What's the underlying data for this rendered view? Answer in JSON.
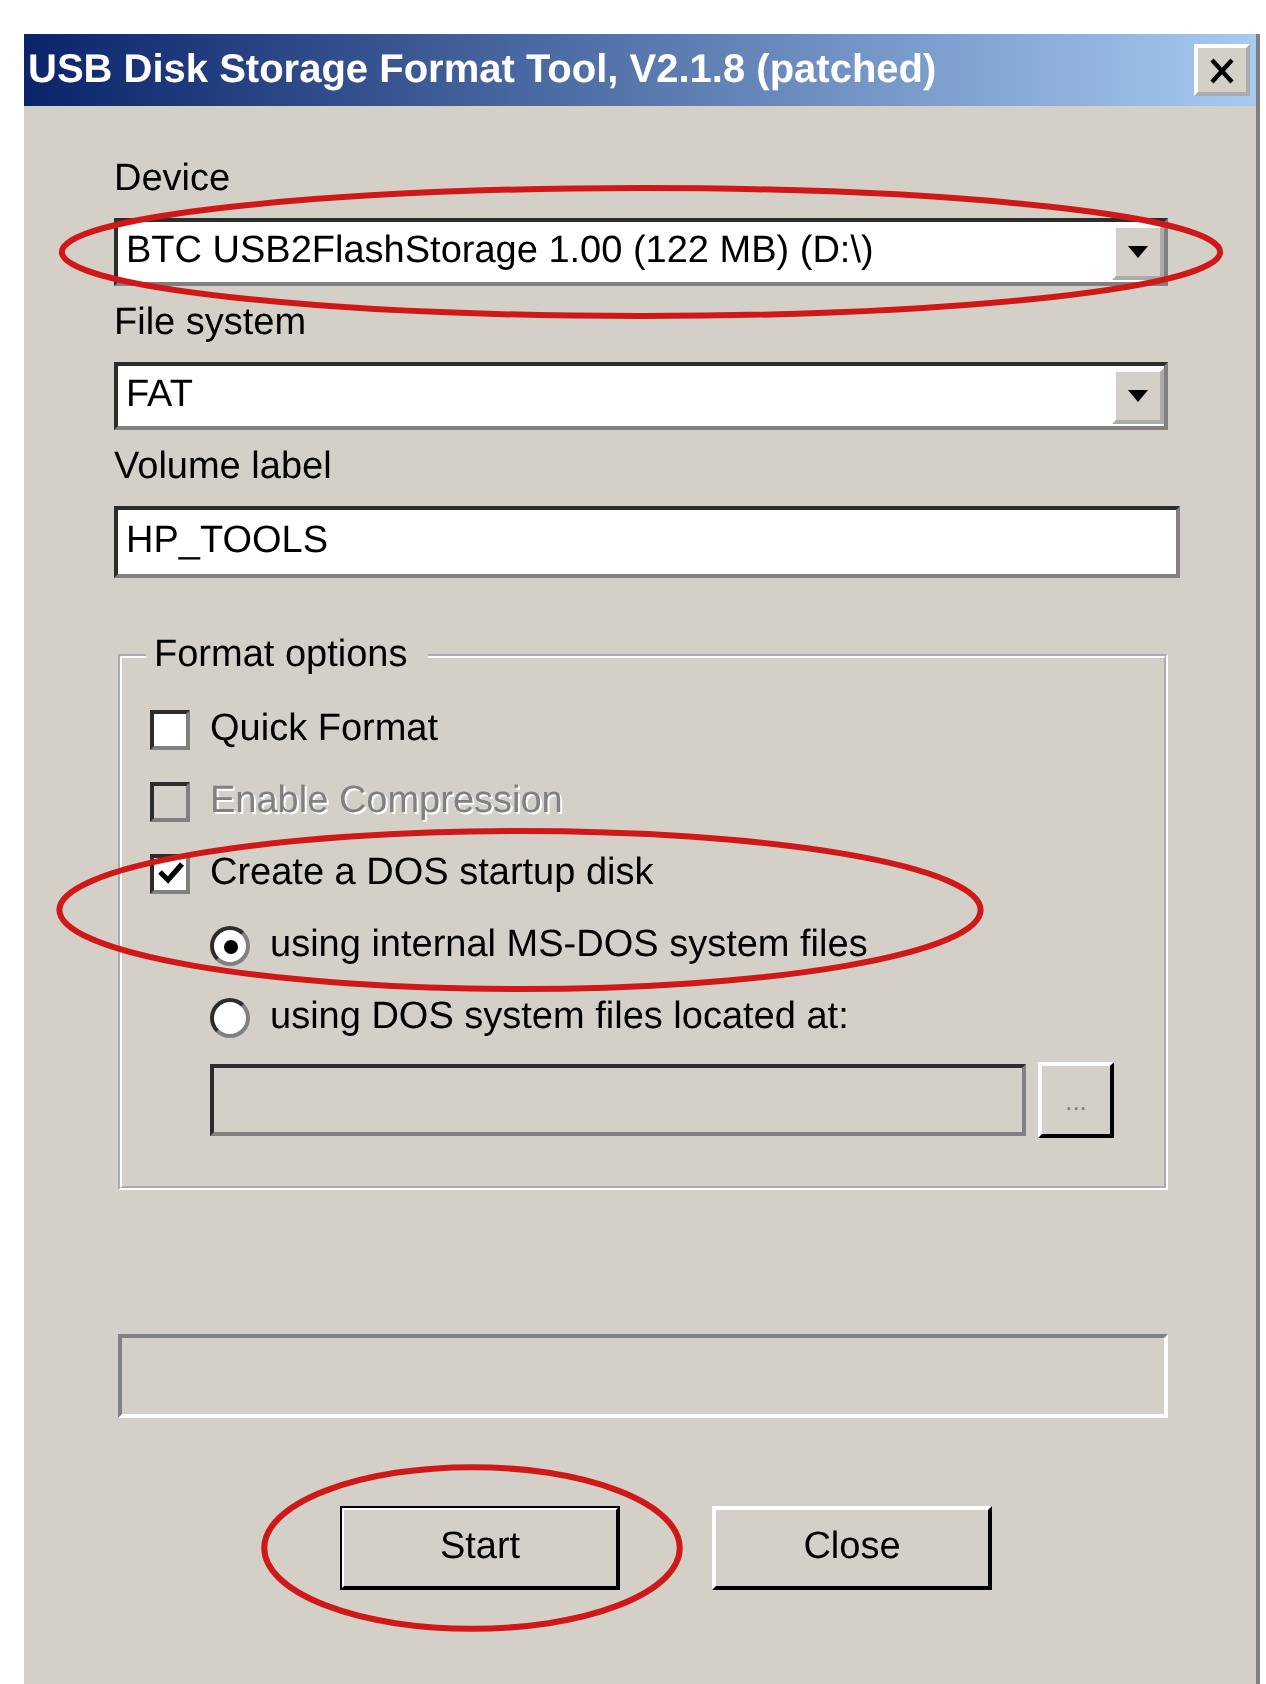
{
  "window": {
    "title": "USB Disk Storage Format Tool, V2.1.8 (patched)"
  },
  "device": {
    "label": "Device",
    "value": "BTC USB2FlashStorage 1.00 (122 MB) (D:\\)",
    "circled": true
  },
  "file_system": {
    "label": "File system",
    "value": "FAT"
  },
  "volume_label": {
    "label": "Volume label",
    "value": "HP_TOOLS"
  },
  "format_options": {
    "title": "Format options",
    "options": [
      {
        "kind": "checkbox",
        "label": "Quick Format",
        "checked": false,
        "disabled": false
      },
      {
        "kind": "checkbox",
        "label": "Enable Compression",
        "checked": false,
        "disabled": true
      },
      {
        "kind": "checkbox",
        "label": "Create a DOS startup disk",
        "checked": true,
        "disabled": false,
        "circled": true
      },
      {
        "kind": "radio",
        "label": "using internal MS-DOS system files",
        "selected": true,
        "disabled": false,
        "circled": true
      },
      {
        "kind": "radio",
        "label": "using DOS system files located at:",
        "selected": false,
        "disabled": false
      }
    ],
    "path_field": {
      "disabled": true
    },
    "browse_button": "..."
  },
  "progress": {
    "level": 0
  },
  "buttons": [
    {
      "label": "Start",
      "default": true,
      "circled": true
    },
    {
      "label": "Close",
      "default": false
    }
  ]
}
